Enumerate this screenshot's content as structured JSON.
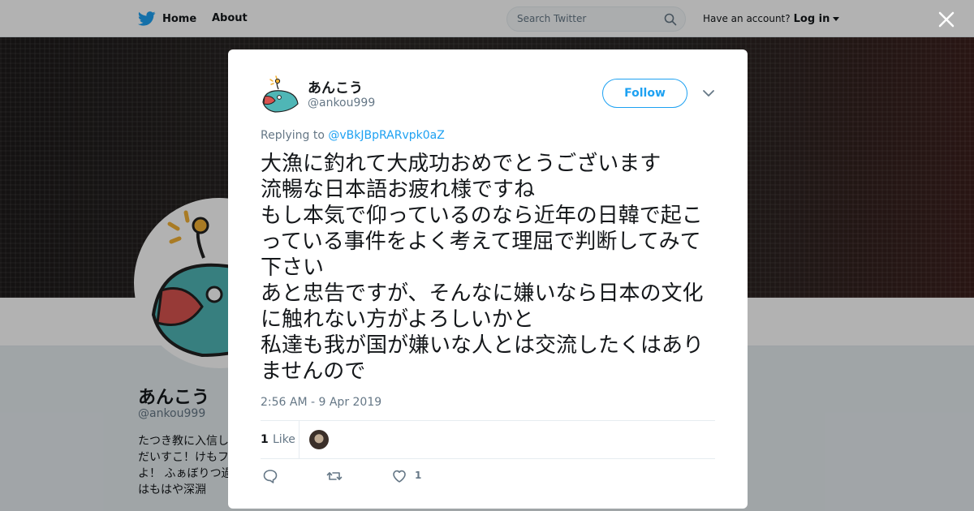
{
  "nav": {
    "home_label": "Home",
    "about_label": "About",
    "search_placeholder": "Search Twitter",
    "have_account": "Have an account?",
    "login_label": "Log in"
  },
  "profile": {
    "name": "あんこう",
    "handle": "@ankou999",
    "bio": "たつき教に入信し\nだいすこ！けもフ\nよ！ ふぁぼりつ過\nはもはや深淵"
  },
  "tweet": {
    "author_name": "あんこう",
    "author_handle": "@ankou999",
    "follow_label": "Follow",
    "replying_prefix": "Replying to",
    "replying_to": "@vBkJBpRARvpk0aZ",
    "text": "大漁に釣れて大成功おめでとうございます\n流暢な日本語お疲れ様ですね\nもし本気で仰っているのなら近年の日韓で起こっている事件をよく考えて理屈で判断してみて下さい\nあと忠告ですが、そんなに嫌いなら日本の文化に触れない方がよろしいかと\n私達も我が国が嫌いな人とは交流したくはありませんので",
    "timestamp": "2:56 AM - 9 Apr 2019",
    "like_count": "1",
    "like_label": "Like",
    "action_like_count": "1"
  },
  "colors": {
    "accent": "#1da1f2",
    "secondary_text": "#657786",
    "avatar_teal": "#4fb6b6"
  },
  "icons": [
    "twitter-bird-icon",
    "search-icon",
    "close-icon",
    "chevron-down-icon",
    "reply-icon",
    "retweet-icon",
    "heart-icon"
  ]
}
